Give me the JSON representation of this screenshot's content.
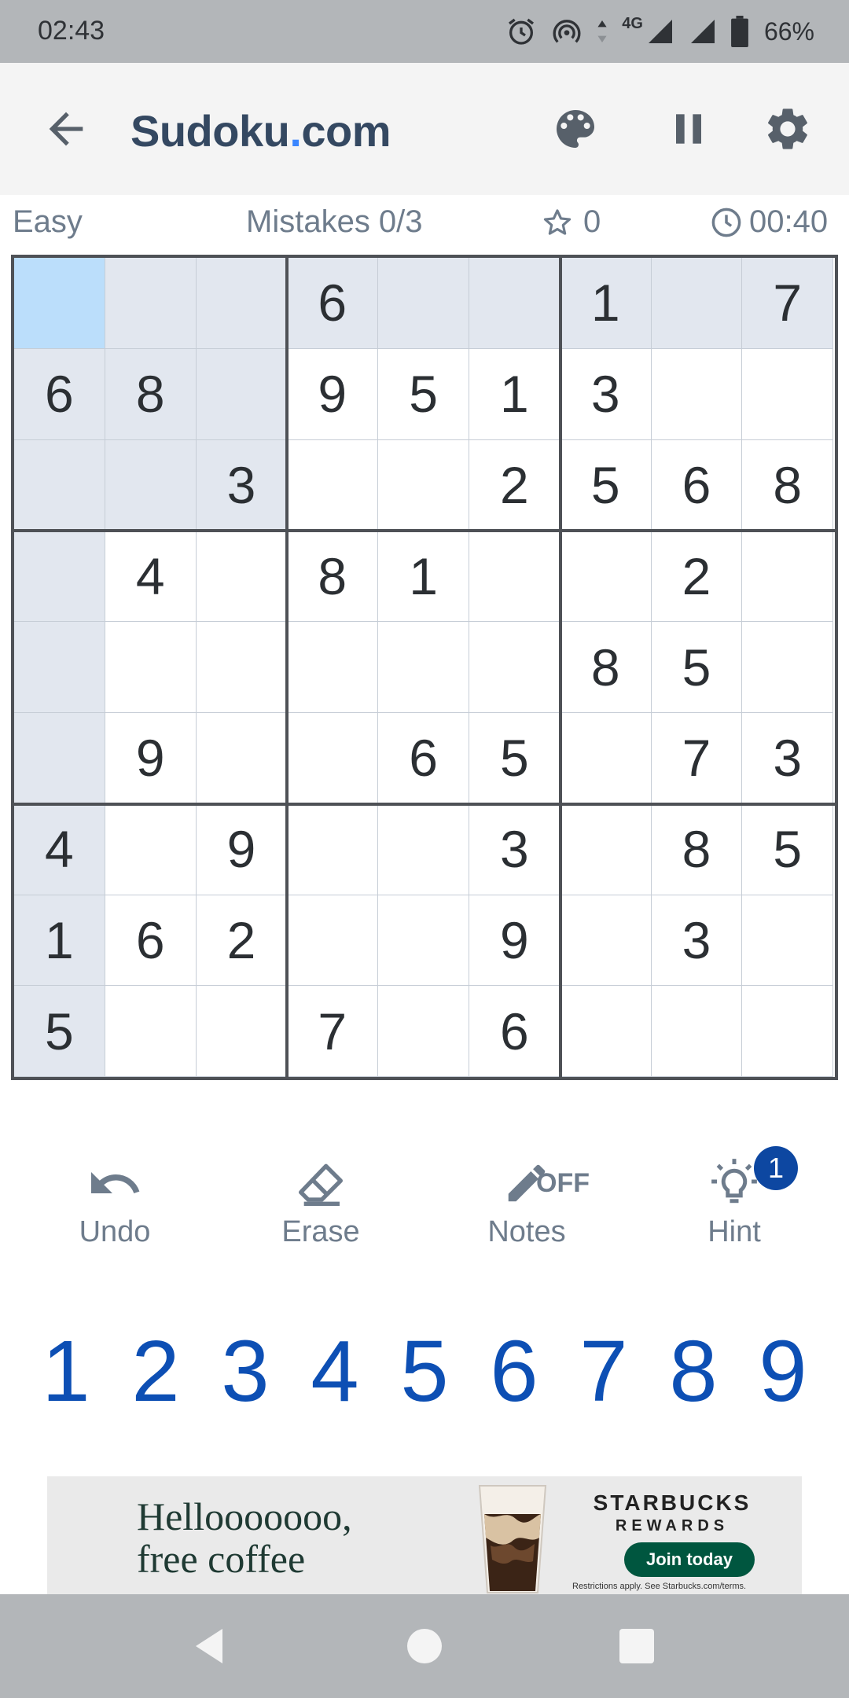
{
  "status_bar": {
    "time": "02:43",
    "network_label": "4G",
    "battery_percent": "66%",
    "icons": [
      "alarm-icon",
      "hotspot-icon",
      "data-arrows-icon",
      "signal-icon",
      "signal-icon",
      "battery-icon"
    ]
  },
  "app_bar": {
    "title_main": "Sudoku",
    "title_dot": ".",
    "title_tld": "com",
    "icons": [
      "back-arrow-icon",
      "palette-icon",
      "pause-icon",
      "gear-icon"
    ]
  },
  "info": {
    "difficulty": "Easy",
    "mistakes": "Mistakes 0/3",
    "score": "0",
    "timer": "00:40"
  },
  "board": {
    "selected": [
      0,
      0
    ],
    "rows": [
      [
        "",
        "",
        "",
        "6",
        "",
        "",
        "1",
        "",
        "7"
      ],
      [
        "6",
        "8",
        "",
        "9",
        "5",
        "1",
        "3",
        "",
        ""
      ],
      [
        "",
        "",
        "3",
        "",
        "",
        "2",
        "5",
        "6",
        "8"
      ],
      [
        "",
        "4",
        "",
        "8",
        "1",
        "",
        "",
        "2",
        ""
      ],
      [
        "",
        "",
        "",
        "",
        "",
        "",
        "8",
        "5",
        ""
      ],
      [
        "",
        "9",
        "",
        "",
        "6",
        "5",
        "",
        "7",
        "3"
      ],
      [
        "4",
        "",
        "9",
        "",
        "",
        "3",
        "",
        "8",
        "5"
      ],
      [
        "1",
        "6",
        "2",
        "",
        "",
        "9",
        "",
        "3",
        ""
      ],
      [
        "5",
        "",
        "",
        "7",
        "",
        "6",
        "",
        "",
        ""
      ]
    ]
  },
  "tools": {
    "undo": "Undo",
    "erase": "Erase",
    "notes": "Notes",
    "notes_state": "OFF",
    "hint": "Hint",
    "hint_count": "1"
  },
  "numpad": [
    "1",
    "2",
    "3",
    "4",
    "5",
    "6",
    "7",
    "8",
    "9"
  ],
  "ad": {
    "headline_line1": "Hellooooooo,",
    "headline_line2": "free coffee",
    "brand": "STARBUCKS",
    "brand_sub": "REWARDS",
    "cta": "Join today",
    "fine_print": "Restrictions apply. See Starbucks.com/terms."
  },
  "colors": {
    "title": "#344861",
    "accent_dot": "#3a86ff",
    "number_pad": "#0d4fb4",
    "highlight": "#e2e7ef",
    "selected": "#bbdefb",
    "hint_badge": "#0d47a1"
  }
}
